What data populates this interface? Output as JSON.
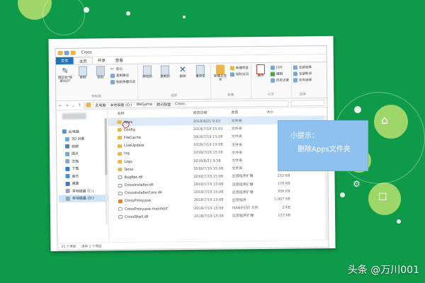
{
  "colors": {
    "background": "#0f9a4a",
    "accent_file_tab": "#1e73be",
    "folder": "#e8b64a",
    "tooltip": "#8ec1ee",
    "selection": "#cce4f7",
    "highlight_ring": "#e3342f"
  },
  "window": {
    "title": "Cross"
  },
  "ribbon": {
    "tabs": [
      "文件",
      "主页",
      "共享",
      "查看"
    ],
    "active_tab": "主页",
    "groups": {
      "clipboard": {
        "label": "剪贴板",
        "pin_label": "固定到\"快速访问\"",
        "copy_label": "复制",
        "paste_label": "粘贴",
        "cut_label": "剪切",
        "copy_path_label": "复制路径",
        "paste_shortcut_label": "粘贴快捷方式"
      },
      "organize": {
        "label": "组织",
        "move_to_label": "移动到",
        "copy_to_label": "复制到",
        "delete_label": "删除",
        "rename_label": "重命名"
      },
      "new": {
        "label": "新建",
        "new_folder_label": "新建文件夹",
        "new_item_label": "新建项目",
        "easy_access_label": "轻松访问"
      },
      "open": {
        "label": "打开",
        "properties_label": "属性",
        "open_label": "打开",
        "edit_label": "编辑",
        "history_label": "历史记录"
      },
      "select": {
        "label": "选择",
        "select_all_label": "全部选择",
        "select_none_label": "全部取消",
        "invert_label": "反向选择"
      }
    }
  },
  "address": {
    "parts": [
      "此电脑",
      "本地磁盘 (D:)",
      "WeGame",
      "腾讯联盟",
      "Cross"
    ]
  },
  "nav": {
    "items": [
      {
        "label": "此电脑",
        "icon": "computer-icon",
        "indent": false,
        "selected": false
      },
      {
        "label": "3D 对象",
        "icon": "cube-icon",
        "indent": true,
        "selected": false
      },
      {
        "label": "视频",
        "icon": "video-icon",
        "indent": true,
        "selected": false
      },
      {
        "label": "图片",
        "icon": "picture-icon",
        "indent": true,
        "selected": false
      },
      {
        "label": "文档",
        "icon": "document-icon",
        "indent": true,
        "selected": false
      },
      {
        "label": "下载",
        "icon": "download-icon",
        "indent": true,
        "selected": false
      },
      {
        "label": "音乐",
        "icon": "music-icon",
        "indent": true,
        "selected": false
      },
      {
        "label": "桌面",
        "icon": "desktop-icon",
        "indent": true,
        "selected": false
      },
      {
        "label": "本地磁盘 (C:)",
        "icon": "drive-icon",
        "indent": true,
        "selected": false
      },
      {
        "label": "本地磁盘 (D:)",
        "icon": "drive-icon",
        "indent": true,
        "selected": true
      }
    ]
  },
  "files": {
    "columns": {
      "name": "名称",
      "date": "修改日期",
      "type": "类型",
      "size": "大小"
    },
    "rows": [
      {
        "name": "Apps",
        "date": "2018/8/21 9:03",
        "type": "文件夹",
        "size": "",
        "kind": "folder",
        "selected": true
      },
      {
        "name": "Config",
        "date": "2018/7/19 15:03",
        "type": "文件夹",
        "size": "",
        "kind": "folder",
        "selected": false
      },
      {
        "name": "FileCache",
        "date": "2018/7/19 15:08",
        "type": "文件夹",
        "size": "",
        "kind": "folder",
        "selected": false
      },
      {
        "name": "LiveUpdate",
        "date": "2018/7/19 15:08",
        "type": "文件夹",
        "size": "",
        "kind": "folder",
        "selected": false
      },
      {
        "name": "log",
        "date": "2018/7/19 15:08",
        "type": "文件夹",
        "size": "",
        "kind": "folder",
        "selected": false
      },
      {
        "name": "Logs",
        "date": "2018/8/21 9:58",
        "type": "文件夹",
        "size": "",
        "kind": "folder",
        "selected": false
      },
      {
        "name": "Tenio",
        "date": "2018/7/19 15:08",
        "type": "文件夹",
        "size": "",
        "kind": "folder",
        "selected": false
      },
      {
        "name": "BugRpt.dll",
        "date": "2018/7/19 15:08",
        "type": "应用程序扩展",
        "size": "252 KB",
        "kind": "dll",
        "selected": false
      },
      {
        "name": "CrossInstaller.dll",
        "date": "2018/7/19 15:08",
        "type": "应用程序扩展",
        "size": "176 KB",
        "kind": "dll",
        "selected": false
      },
      {
        "name": "CrossInstallerCore.dll",
        "date": "2018/7/19 15:08",
        "type": "应用程序扩展",
        "size": "356 KB",
        "kind": "dll",
        "selected": false
      },
      {
        "name": "CrossProxy.exe",
        "date": "2018/7/19 15:08",
        "type": "应用程序",
        "size": "1,007 KB",
        "kind": "exe",
        "selected": false
      },
      {
        "name": "CrossProxy.exe.manifest",
        "date": "2018/7/19 15:08",
        "type": "MANIFEST 文件",
        "size": "2 KB",
        "kind": "file",
        "selected": false
      },
      {
        "name": "CrossShell.dll",
        "date": "2018/7/19 15:08",
        "type": "应用程序扩展",
        "size": "133 KB",
        "kind": "dll",
        "selected": false
      }
    ]
  },
  "status": {
    "count": "25 个项目",
    "selected": "选中 1 个项目"
  },
  "tooltip": {
    "title": "小提示：",
    "body": "删除Apps文件夹"
  },
  "watermark": "头条 @万川001"
}
